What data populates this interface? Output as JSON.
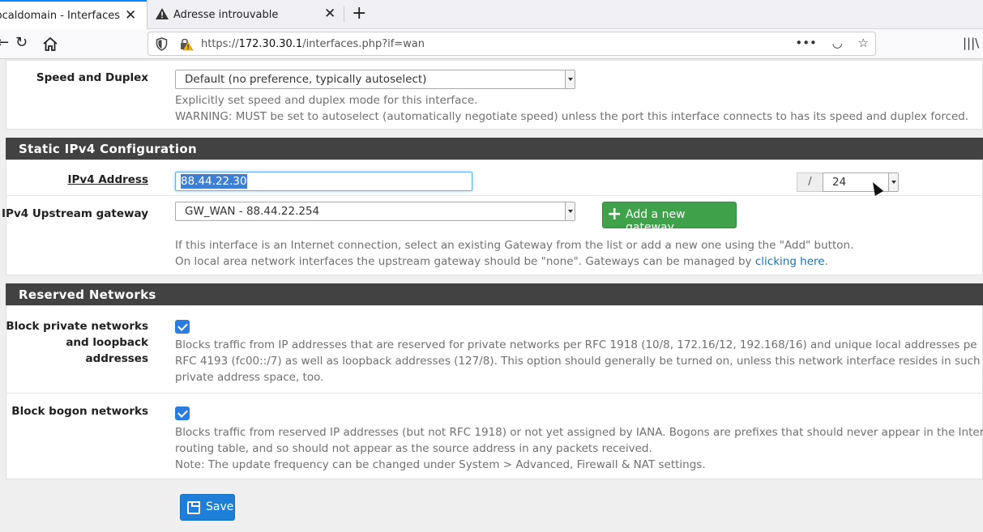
{
  "browser": {
    "tabs": [
      {
        "title": "nse.localdomain - Interfaces",
        "active": true
      },
      {
        "title": "Adresse introuvable",
        "active": false
      }
    ],
    "url_prefix": "https://",
    "url_host": "172.30.30.1",
    "url_path": "/interfaces.php?if=wan"
  },
  "speed_duplex": {
    "label": "Speed and Duplex",
    "value": "Default (no preference, typically autoselect)",
    "help_line1": "Explicitly set speed and duplex mode for this interface.",
    "help_line2": "WARNING: MUST be set to autoselect (automatically negotiate speed) unless the port this interface connects to has its speed and duplex forced."
  },
  "static_ipv4": {
    "heading": "Static IPv4 Configuration",
    "address_label": "IPv4 Address",
    "address_value": "88.44.22.30",
    "slash": "/",
    "cidr_value": "24",
    "gateway_label": "IPv4 Upstream gateway",
    "gateway_value": "GW_WAN - 88.44.22.254",
    "add_gateway_label": "Add a new gateway",
    "help_line1": "If this interface is an Internet connection, select an existing Gateway from the list or add a new one using the \"Add\" button.",
    "help_line2_prefix": "On local area network interfaces the upstream gateway should be \"none\". Gateways can be managed by ",
    "help_link": "clicking here",
    "help_line2_suffix": "."
  },
  "reserved": {
    "heading": "Reserved Networks",
    "private_label_1": "Block private networks",
    "private_label_2": "and loopback addresses",
    "private_help_1": "Blocks traffic from IP addresses that are reserved for private networks per RFC 1918 (10/8, 172.16/12, 192.168/16) and unique local addresses pe",
    "private_help_2": "RFC 4193 (fc00::/7) as well as loopback addresses (127/8). This option should generally be turned on, unless this network interface resides in such",
    "private_help_3": "private address space, too.",
    "bogon_label": "Block bogon networks",
    "bogon_help_1": "Blocks traffic from reserved IP addresses (but not RFC 1918) or not yet assigned by IANA. Bogons are prefixes that should never appear in the Inter",
    "bogon_help_2": "routing table, and so should not appear as the source address in any packets received.",
    "bogon_help_3": "Note: The update frequency can be changed under System > Advanced, Firewall & NAT settings."
  },
  "save_label": "Save"
}
